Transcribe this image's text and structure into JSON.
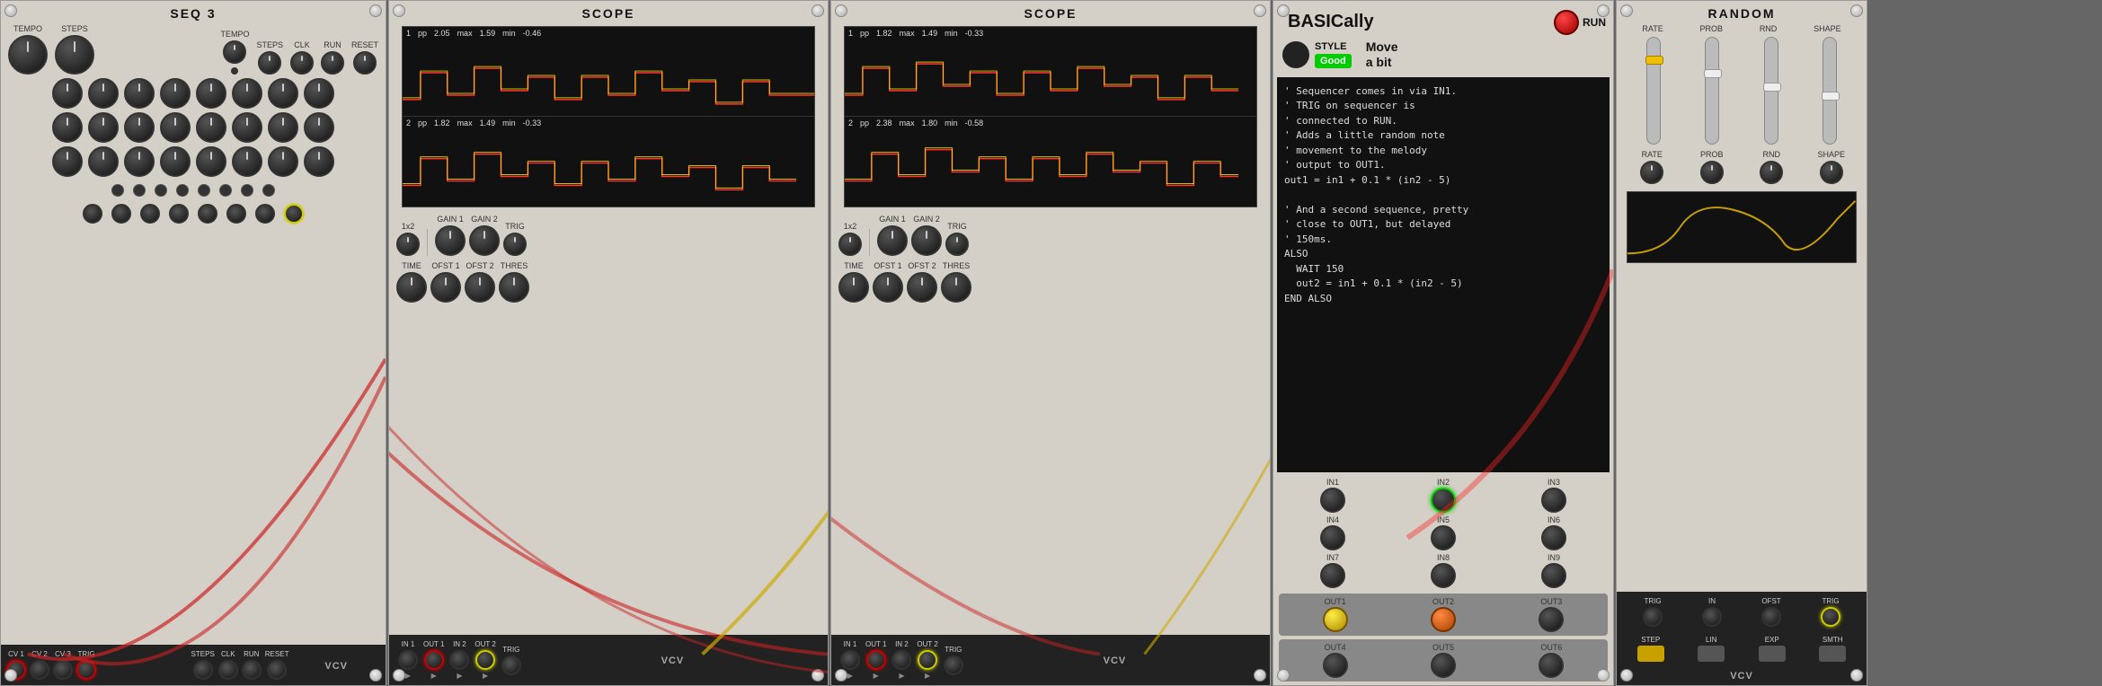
{
  "modules": {
    "seq3": {
      "title": "SEQ 3",
      "labels": {
        "tempo": "TEMPO",
        "steps": "STEPS",
        "tempo2": "TEMPO",
        "steps2": "STEPS",
        "clk": "CLK",
        "run": "RUN",
        "reset": "RESET",
        "cv1": "CV 1",
        "cv2": "CV 2",
        "cv3": "CV 3",
        "trig": "TRIG",
        "steps_j": "STEPS",
        "clk_j": "CLK",
        "run_j": "RUN",
        "reset_j": "RESET"
      },
      "logo": "VCV"
    },
    "scope1": {
      "title": "SCOPE",
      "ch1": {
        "pp": "pp",
        "pp_val": "2.05",
        "max": "max",
        "max_val": "1.59",
        "min": "min",
        "min_val": "-0.46"
      },
      "ch2": {
        "pp": "pp",
        "pp_val": "1.82",
        "max": "max",
        "max_val": "1.49",
        "min": "min",
        "min_val": "-0.33"
      },
      "labels": {
        "1x2": "1x2",
        "gain1": "GAIN 1",
        "gain2": "GAIN 2",
        "trig": "TRIG",
        "time": "TIME",
        "ofst1": "OFST 1",
        "ofst2": "OFST 2",
        "thres": "THRES",
        "in1": "IN 1",
        "out1": "OUT 1",
        "in2": "IN 2",
        "out2": "OUT 2"
      },
      "logo": "VCV"
    },
    "scope2": {
      "title": "SCOPE",
      "ch1": {
        "pp": "pp",
        "pp_val": "1.82",
        "max": "max",
        "max_val": "1.49",
        "min": "min",
        "min_val": "-0.33"
      },
      "ch2": {
        "pp": "pp",
        "pp_val": "2.38",
        "max": "max",
        "max_val": "1.80",
        "min": "min",
        "min_val": "-0.58"
      },
      "labels": {
        "1x2": "1x2",
        "gain1": "GAIN 1",
        "gain2": "GAIN 2",
        "trig": "TRIG",
        "time": "TIME",
        "ofst1": "OFST 1",
        "ofst2": "OFST 2",
        "thres": "THRES",
        "in1": "IN 1",
        "out1": "OUT 1",
        "in2": "IN 2",
        "out2": "OUT 2"
      },
      "logo": "VCV"
    },
    "basically": {
      "title": "BASICally",
      "run_label": "RUN",
      "style_label": "STYLE",
      "good_label": "Good",
      "move_label": "Move\na bit",
      "code": "' Sequencer comes in via IN1.\n' TRIG on sequencer is\n' connected to RUN.\n' Adds a little random note\n' movement to the melody\n' output to OUT1.\nout1 = in1 + 0.1 * (in2 - 5)\n\n' And a second sequence, pretty\n' close to OUT1, but delayed\n' 150ms.\nALSO\n  WAIT 150\n  out2 = in1 + 0.1 * (in2 - 5)\nEND ALSO",
      "in_labels": [
        "IN1",
        "IN2",
        "IN3",
        "IN4",
        "IN5",
        "IN6",
        "IN7",
        "IN8",
        "IN9"
      ],
      "out_labels": [
        "OUT1",
        "OUT2",
        "OUT3",
        "OUT4",
        "OUT5",
        "OUT6"
      ]
    },
    "random": {
      "title": "RANDOM",
      "slider_labels": [
        "RATE",
        "PROB",
        "RND",
        "SHAPE"
      ],
      "knob_labels": [
        "RATE",
        "PROB",
        "RND",
        "SHAPE"
      ],
      "jack_labels": [
        "TRIG",
        "IN",
        "OFST",
        "TRIG"
      ],
      "interp_labels": [
        "STEP",
        "LIN",
        "EXP",
        "SMTH"
      ],
      "logo": "VCV"
    }
  }
}
